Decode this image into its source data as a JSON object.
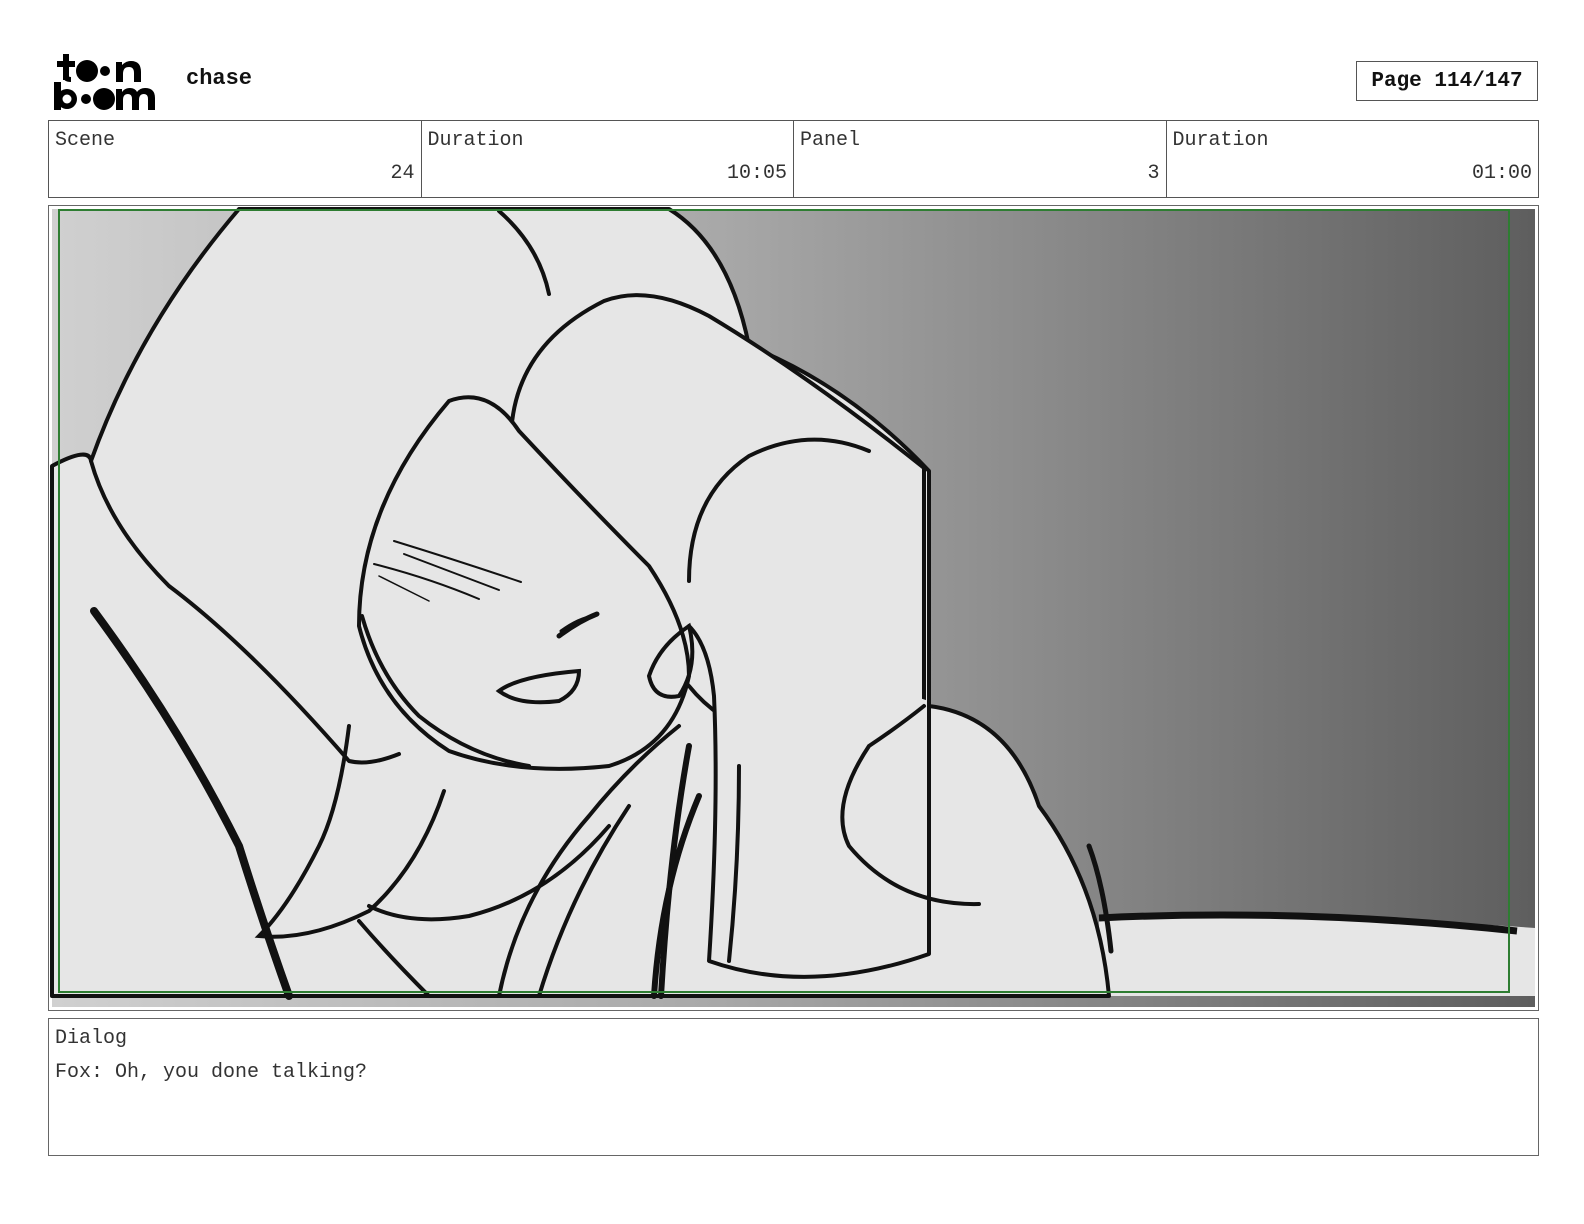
{
  "header": {
    "logo_text_top": "toon",
    "logo_text_bottom": "boom",
    "project_title": "chase",
    "page_label": "Page 114/147"
  },
  "info": {
    "scene_label": "Scene",
    "scene_value": "24",
    "scene_duration_label": "Duration",
    "scene_duration_value": "10:05",
    "panel_label": "Panel",
    "panel_value": "3",
    "panel_duration_label": "Duration",
    "panel_duration_value": "01:00"
  },
  "dialog": {
    "label": "Dialog",
    "text": "Fox: Oh, you done talking?"
  },
  "colors": {
    "safe_frame": "#2e7d32",
    "background_gradient_start": "#cfcfcf",
    "background_gradient_end": "#5e5e5e",
    "character_fill": "#e6e6e6"
  }
}
